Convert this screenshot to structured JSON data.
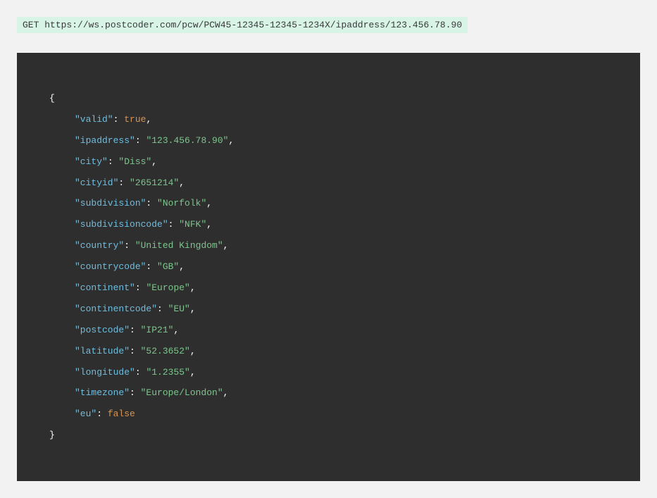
{
  "request": {
    "method": "GET",
    "url": "https://ws.postcoder.com/pcw/PCW45-12345-12345-1234X/ipaddress/123.456.78.90"
  },
  "json": {
    "open_brace": "{",
    "close_brace": "}",
    "entries": [
      {
        "key": "\"valid\"",
        "sep": ": ",
        "value": "true",
        "type": "boolean-true",
        "comma": ","
      },
      {
        "key": "\"ipaddress\"",
        "sep": ": ",
        "value": "\"123.456.78.90\"",
        "type": "string",
        "comma": ","
      },
      {
        "key": "\"city\"",
        "sep": ": ",
        "value": "\"Diss\"",
        "type": "string",
        "comma": ","
      },
      {
        "key": "\"cityid\"",
        "sep": ": ",
        "value": "\"2651214\"",
        "type": "string",
        "comma": ","
      },
      {
        "key": "\"subdivision\"",
        "sep": ": ",
        "value": "\"Norfolk\"",
        "type": "string",
        "comma": ","
      },
      {
        "key": "\"subdivisioncode\"",
        "sep": ": ",
        "value": "\"NFK\"",
        "type": "string",
        "comma": ","
      },
      {
        "key": "\"country\"",
        "sep": ": ",
        "value": "\"United Kingdom\"",
        "type": "string",
        "comma": ","
      },
      {
        "key": "\"countrycode\"",
        "sep": ": ",
        "value": "\"GB\"",
        "type": "string",
        "comma": ","
      },
      {
        "key": "\"continent\"",
        "sep": ": ",
        "value": "\"Europe\"",
        "type": "string",
        "comma": ","
      },
      {
        "key": "\"continentcode\"",
        "sep": ": ",
        "value": "\"EU\"",
        "type": "string",
        "comma": ","
      },
      {
        "key": "\"postcode\"",
        "sep": ": ",
        "value": "\"IP21\"",
        "type": "string",
        "comma": ","
      },
      {
        "key": "\"latitude\"",
        "sep": ": ",
        "value": "\"52.3652\"",
        "type": "string",
        "comma": ","
      },
      {
        "key": "\"longitude\"",
        "sep": ": ",
        "value": "\"1.2355\"",
        "type": "string",
        "comma": ","
      },
      {
        "key": "\"timezone\"",
        "sep": ": ",
        "value": "\"Europe/London\"",
        "type": "string",
        "comma": ","
      },
      {
        "key": "\"eu\"",
        "sep": ": ",
        "value": "false",
        "type": "boolean-false",
        "comma": ""
      }
    ]
  }
}
